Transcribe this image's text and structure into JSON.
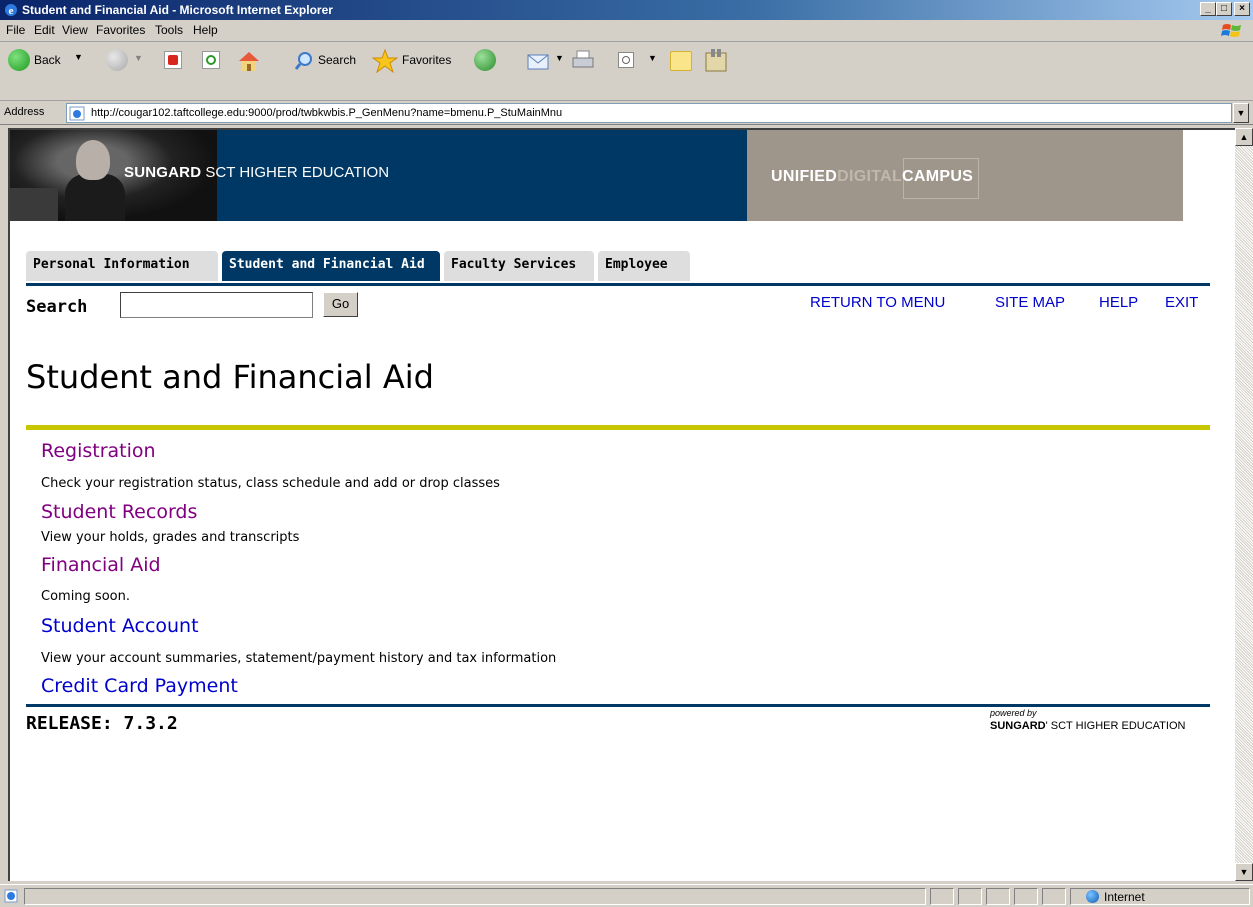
{
  "window": {
    "title": "Student and Financial Aid - Microsoft Internet Explorer",
    "minimize": "_",
    "maximize": "□",
    "close": "×"
  },
  "menubar": {
    "items": [
      "File",
      "Edit",
      "View",
      "Favorites",
      "Tools",
      "Help"
    ]
  },
  "toolbar": {
    "back": "Back",
    "search": "Search",
    "favorites": "Favorites"
  },
  "address": {
    "label": "Address",
    "url": "http://cougar102.taftcollege.edu:9000/prod/twbkwbis.P_GenMenu?name=bmenu.P_StuMainMnu"
  },
  "banner": {
    "brand_bold": "SUNGARD",
    "brand_rest": " SCT HIGHER EDUCATION",
    "udc_unified": "UNIFIED",
    "udc_digital": "DIGITAL",
    "udc_campus": "CAMPUS"
  },
  "tabs": [
    {
      "label": "Personal Information",
      "active": false
    },
    {
      "label": "Student and Financial Aid",
      "active": true
    },
    {
      "label": "Faculty Services",
      "active": false
    },
    {
      "label": "Employee",
      "active": false
    }
  ],
  "search": {
    "label": "Search",
    "value": "",
    "go": "Go"
  },
  "toplinks": {
    "return": "RETURN TO MENU",
    "sitemap": "SITE MAP",
    "help": "HELP",
    "exit": "EXIT"
  },
  "page": {
    "title": "Student and Financial Aid"
  },
  "menu": [
    {
      "link": "Registration",
      "desc": "Check your registration status, class schedule and add or drop classes",
      "visited": true
    },
    {
      "link": "Student Records",
      "desc": "View your holds, grades and transcripts",
      "visited": true
    },
    {
      "link": "Financial Aid",
      "desc": "Coming soon.",
      "visited": true
    },
    {
      "link": "Student Account",
      "desc": "View your account summaries, statement/payment history and tax information",
      "visited": false
    },
    {
      "link": "Credit Card Payment",
      "desc": "",
      "visited": false
    }
  ],
  "footer": {
    "release": "RELEASE: 7.3.2",
    "powered_by": "powered by",
    "powered_brand_bold": "SUNGARD",
    "powered_brand_rest": "' SCT HIGHER EDUCATION"
  },
  "statusbar": {
    "zone": "Internet"
  },
  "colors": {
    "banner_blue": "#003865",
    "banner_taupe": "#9e958b",
    "yellow_rule": "#c8c600",
    "visited_link": "#800080",
    "link": "#0000cc"
  }
}
